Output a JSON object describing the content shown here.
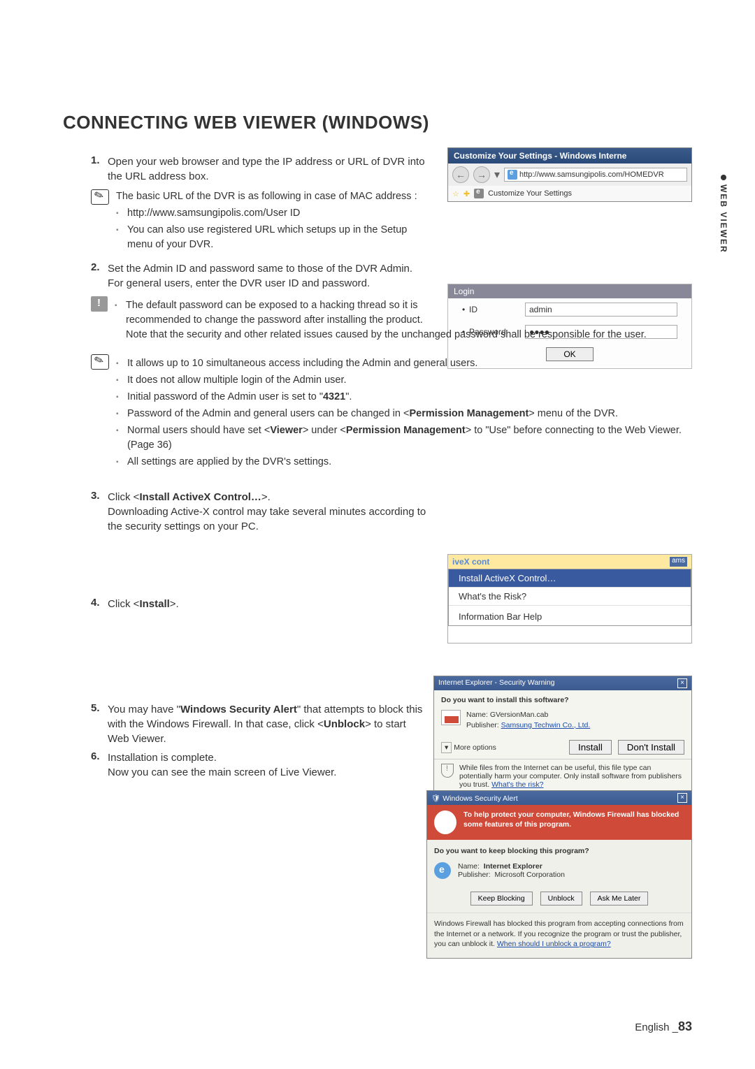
{
  "page_title": "CONNECTING WEB VIEWER (WINDOWS)",
  "side_tab": "WEB VIEWER",
  "steps": {
    "s1": "Open your web browser and type the IP address or URL of DVR into the URL address box.",
    "s2a": "Set the Admin ID and password same to those of the DVR Admin.",
    "s2b": "For general users, enter the DVR user ID and password.",
    "s3a_prefix": "Click <",
    "s3a_bold": "Install ActiveX Control…",
    "s3a_suffix": ">.",
    "s3b": "Downloading Active-X control may take several minutes according to the security settings on your PC.",
    "s4_prefix": "Click <",
    "s4_bold": "Install",
    "s4_suffix": ">.",
    "s5a": "You may have \"",
    "s5a_bold": "Windows Security Alert",
    "s5a_mid": "\" that attempts to block this with the Windows Firewall. In that case, click <",
    "s5a_bold2": "Unblock",
    "s5a_end": "> to start Web Viewer.",
    "s6a": "Installation is complete.",
    "s6b": "Now you can see the main screen of Live Viewer."
  },
  "note1": {
    "intro": "The basic URL of the DVR is as following in case of MAC address :",
    "b1": "http://www.samsungipolis.com/User ID",
    "b2": "You can also use registered URL which setups up in the Setup menu of your DVR."
  },
  "warn1": {
    "b1": "The default password can be exposed to a hacking thread so it is recommended to change the password after installing the product.",
    "b2": "Note that the security and other related issues caused by the unchanged password shall be responsible for the user."
  },
  "note2": {
    "b1": "It allows up to 10 simultaneous access including the Admin and general users.",
    "b2": "It does not allow multiple login of the Admin user.",
    "b3_pre": "Initial password of the Admin user is set to \"",
    "b3_bold": "4321",
    "b3_post": "\".",
    "b4_pre": "Password of the Admin and general users can be changed in <",
    "b4_bold": "Permission Management",
    "b4_post": "> menu of the DVR.",
    "b5_pre": "Normal users should have set <",
    "b5_b1": "Viewer",
    "b5_mid": "> under <",
    "b5_b2": "Permission Management",
    "b5_post": "> to \"Use\" before connecting to the Web Viewer. (Page 36)",
    "b6": "All settings are applied by the DVR's settings."
  },
  "fig1": {
    "title": "Customize Your Settings - Windows Interne",
    "url": "http://www.samsungipolis.com/HOMEDVR",
    "tab": "Customize Your Settings"
  },
  "fig2": {
    "head": "Login",
    "id_label": "ID",
    "id_value": "admin",
    "pw_label": "Password",
    "pw_value": "●●●●",
    "ok": "OK"
  },
  "fig3": {
    "bar_left": "iveX cont",
    "bar_right": "ams",
    "m1": "Install ActiveX Control…",
    "m2": "What's the Risk?",
    "m3": "Information Bar Help"
  },
  "fig4": {
    "title": "Internet Explorer - Security Warning",
    "q": "Do you want to install this software?",
    "name_l": "Name:",
    "name_v": "GVersionMan.cab",
    "pub_l": "Publisher:",
    "pub_v": "Samsung Techwin Co., Ltd.",
    "more": "More options",
    "install": "Install",
    "dont": "Don't Install",
    "warn": "While files from the Internet can be useful, this file type can potentially harm your computer. Only install software from publishers you trust.",
    "warn_link": "What's the risk?"
  },
  "fig5": {
    "title": "Windows Security Alert",
    "head": "To help protect your computer, Windows Firewall has blocked some features of this program.",
    "q": "Do you want to keep blocking this program?",
    "name_l": "Name:",
    "name_v": "Internet Explorer",
    "pub_l": "Publisher:",
    "pub_v": "Microsoft Corporation",
    "b1": "Keep Blocking",
    "b2": "Unblock",
    "b3": "Ask Me Later",
    "note": "Windows Firewall has blocked this program from accepting connections from the Internet or a network. If you recognize the program or trust the publisher, you can unblock it.",
    "note_link": "When should I unblock a program?"
  },
  "footer": {
    "lang": "English",
    "page": "83"
  }
}
